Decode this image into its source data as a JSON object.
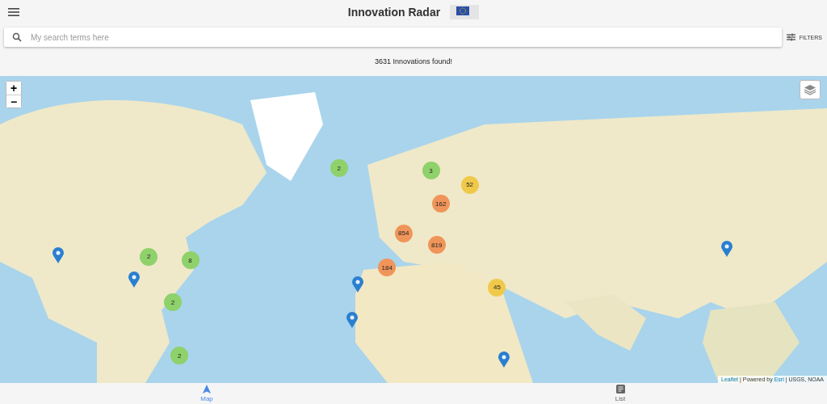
{
  "header": {
    "title": "Innovation Radar"
  },
  "search": {
    "placeholder": "My search terms here",
    "filters_label": "FILTERS"
  },
  "results": {
    "text": "3631 Innovations found!"
  },
  "map": {
    "zoom_in": "+",
    "zoom_out": "−",
    "clusters": [
      {
        "count": "2",
        "color": "#8fd16a"
      },
      {
        "count": "3",
        "color": "#8fd16a"
      },
      {
        "count": "52",
        "color": "#f0c94a"
      },
      {
        "count": "162",
        "color": "#f0955a"
      },
      {
        "count": "854",
        "color": "#f0955a"
      },
      {
        "count": "819",
        "color": "#f0955a"
      },
      {
        "count": "184",
        "color": "#f0955a"
      },
      {
        "count": "2",
        "color": "#8fd16a"
      },
      {
        "count": "8",
        "color": "#8fd16a"
      },
      {
        "count": "2",
        "color": "#8fd16a"
      },
      {
        "count": "2",
        "color": "#8fd16a"
      },
      {
        "count": "45",
        "color": "#f0c94a"
      }
    ],
    "attribution": [
      {
        "kind": "link",
        "text": "Leaflet"
      },
      {
        "kind": "text",
        "text": " | Powered by "
      },
      {
        "kind": "link",
        "text": "Esri"
      },
      {
        "kind": "text",
        "text": " | USGS, NOAA"
      }
    ]
  },
  "nav": [
    {
      "label": "Map",
      "selected": true,
      "kind": "map"
    },
    {
      "label": "List",
      "selected": false,
      "kind": "list"
    }
  ]
}
